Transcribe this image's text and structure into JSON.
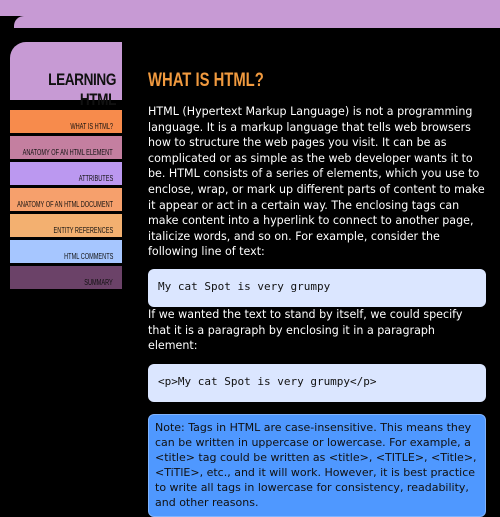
{
  "header": {
    "logo_text": "LEARNING HTML",
    "page_title": "WHAT IS HTML?"
  },
  "colors": {
    "lavender": "#c79ad4",
    "orange": "#f19a3f",
    "code_bg": "#dbe6ff",
    "note_bg": "#4f98ff"
  },
  "nav": {
    "items": [
      {
        "label": "What is HTML?",
        "color": "#f78b4c"
      },
      {
        "label": "Anatomy of an HTML element",
        "color": "#c47fa0"
      },
      {
        "label": "Attributes",
        "color": "#bb98f0"
      },
      {
        "label": "Anatomy of an HTML document",
        "color": "#f6a06c"
      },
      {
        "label": "Entity references",
        "color": "#f3b070"
      },
      {
        "label": "HTML comments",
        "color": "#a6c6ff"
      },
      {
        "label": "Summary",
        "color": "#6b4268"
      }
    ]
  },
  "content": {
    "intro": "HTML (Hypertext Markup Language) is not a programming language. It is a markup language that tells web browsers how to structure the web pages you visit. It can be as complicated or as simple as the web developer wants it to be. HTML consists of a series of elements, which you use to enclose, wrap, or mark up different parts of content to make it appear or act in a certain way. The enclosing tags can make content into a hyperlink to connect to another page, italicize words, and so on. For example, consider the following line of text:",
    "code1": "My cat Spot is very grumpy",
    "paragraph2": "If we wanted the text to stand by itself, we could specify that it is a paragraph by enclosing it in a paragraph element:",
    "code2": "<p>My cat Spot is very grumpy</p>",
    "note": "Note: Tags in HTML are case-insensitive. This means they can be written in uppercase or lowercase. For example, a <title> tag could be written as <title>, <TITLE>, <Title>, <TiTlE>, etc., and it will work. However, it is best practice to write all tags in lowercase for consistency, readability, and other reasons."
  }
}
